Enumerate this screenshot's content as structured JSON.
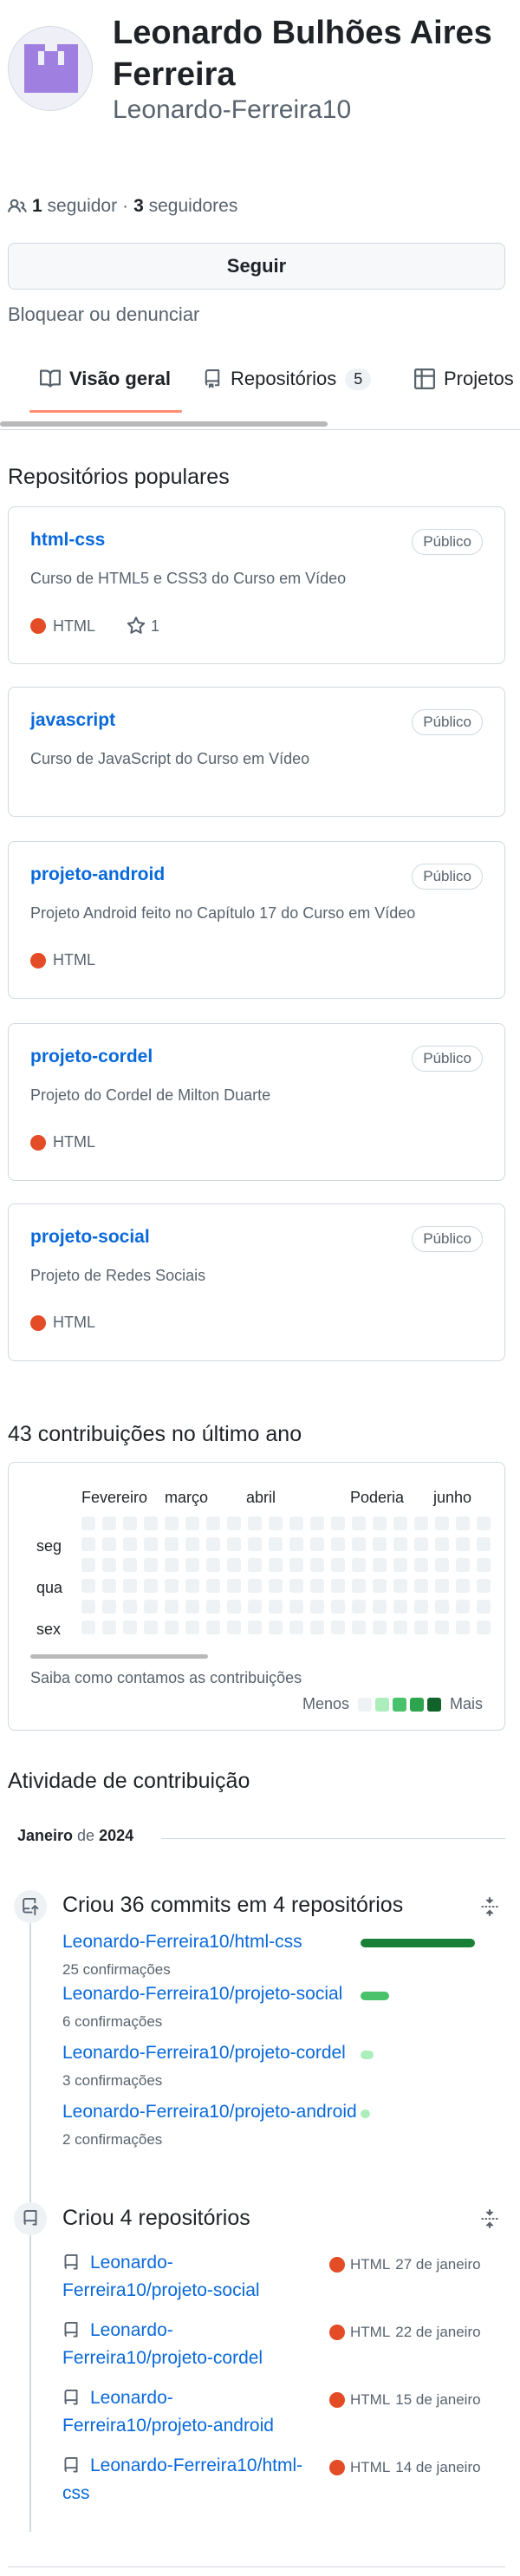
{
  "profile": {
    "name": "Leonardo Bulhões Aires Ferreira",
    "login": "Leonardo-Ferreira10",
    "followers_count": "1",
    "followers_label": "seguidor",
    "separator": "·",
    "following_count": "3",
    "following_label": "seguidores",
    "follow_button": "Seguir",
    "block_link": "Bloquear ou denunciar"
  },
  "tabs": [
    {
      "label": "Visão geral",
      "count": "",
      "icon": "book-icon"
    },
    {
      "label": "Repositórios",
      "count": "5",
      "icon": "repo-icon"
    },
    {
      "label": "Projetos",
      "count": "",
      "icon": "table-icon"
    }
  ],
  "popular": {
    "title": "Repositórios populares",
    "repos": [
      {
        "name": "html-css",
        "visibility": "Público",
        "description": "Curso de HTML5 e CSS3 do Curso em Vídeo",
        "language": "HTML",
        "stars": "1"
      },
      {
        "name": "javascript",
        "visibility": "Público",
        "description": "Curso de JavaScript do Curso em Vídeo",
        "language": "",
        "stars": ""
      },
      {
        "name": "projeto-android",
        "visibility": "Público",
        "description": "Projeto Android feito no Capítulo 17 do Curso em Vídeo",
        "language": "HTML",
        "stars": ""
      },
      {
        "name": "projeto-cordel",
        "visibility": "Público",
        "description": "Projeto do Cordel de Milton Duarte",
        "language": "HTML",
        "stars": ""
      },
      {
        "name": "projeto-social",
        "visibility": "Público",
        "description": "Projeto de Redes Sociais",
        "language": "HTML",
        "stars": ""
      }
    ],
    "language_color": "#e34c26"
  },
  "contributions": {
    "title": "43 contribuições no último ano",
    "months": [
      "Fevereiro",
      "março",
      "abril",
      "Poderia",
      "junho"
    ],
    "days": [
      "seg",
      "qua",
      "sex"
    ],
    "learn_link": "Saiba como contamos as contribuições",
    "legend_less": "Menos",
    "legend_more": "Mais",
    "legend_colors": [
      "#eff2f5",
      "#aceebb",
      "#4ac26b",
      "#2da44e",
      "#116329"
    ]
  },
  "activity": {
    "title": "Atividade de contribuição",
    "month_label": "Janeiro",
    "month_connector": "de",
    "year": "2024",
    "commits": {
      "title": "Criou 36 commits em 4 repositórios",
      "items": [
        {
          "repo": "Leonardo-Ferreira10/html-css",
          "count": "25 confirmações",
          "share": 0.69
        },
        {
          "repo": "Leonardo-Ferreira10/projeto-social",
          "count": "6 confirmações",
          "share": 0.17
        },
        {
          "repo": "Leonardo-Ferreira10/projeto-cordel",
          "count": "3 confirmações",
          "share": 0.08
        },
        {
          "repo": "Leonardo-Ferreira10/projeto-android",
          "count": "2 confirmações",
          "share": 0.06
        }
      ]
    },
    "created": {
      "title": "Criou 4 repositórios",
      "items": [
        {
          "line1": "Leonardo-",
          "line2": "Ferreira10/projeto-social",
          "language": "HTML",
          "date": "27 de janeiro"
        },
        {
          "line1": "Leonardo-",
          "line2": "Ferreira10/projeto-cordel",
          "language": "HTML",
          "date": "22 de janeiro"
        },
        {
          "line1": "Leonardo-",
          "line2": "Ferreira10/projeto-android",
          "language": "HTML",
          "date": "15 de janeiro"
        },
        {
          "line1": "Leonardo-Ferreira10/html-",
          "line2": "css",
          "language": "HTML",
          "date": "14 de janeiro"
        }
      ]
    }
  }
}
